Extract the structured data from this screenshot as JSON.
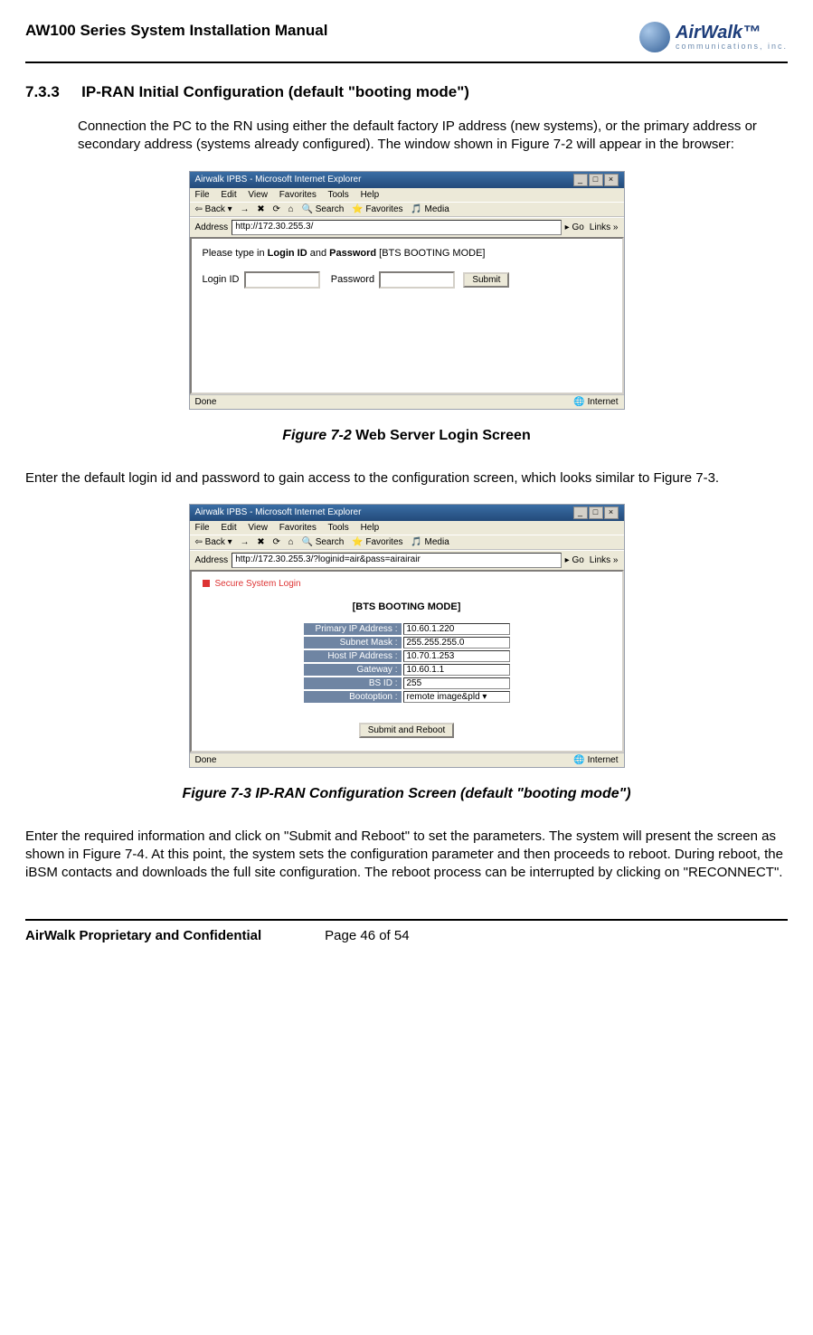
{
  "header": {
    "doc_title": "AW100 Series System Installation Manual",
    "logo_brand": "AirWalk",
    "logo_sub": "communications, inc."
  },
  "section": {
    "number": "7.3.3",
    "title": "IP-RAN Initial Configuration (default \"booting mode\")"
  },
  "para1": "Connection the PC to the RN using either the default factory IP address (new systems), or the primary address or secondary address (systems already configured). The window shown in Figure 7-2 will appear in the browser:",
  "fig1": {
    "window_title": "Airwalk IPBS - Microsoft Internet Explorer",
    "menubar": [
      "File",
      "Edit",
      "View",
      "Favorites",
      "Tools",
      "Help"
    ],
    "toolbar": {
      "back": "Back",
      "search": "Search",
      "favorites": "Favorites",
      "media": "Media"
    },
    "address_label": "Address",
    "address_url": "http://172.30.255.3/",
    "go": "Go",
    "links": "Links",
    "instruction_prefix": "Please type in ",
    "instruction_login": "Login ID",
    "instruction_and": " and ",
    "instruction_pass": "Password",
    "instruction_mode": " [BTS BOOTING MODE]",
    "login_label": "Login ID",
    "password_label": "Password",
    "submit": "Submit",
    "status_done": "Done",
    "status_net": "Internet"
  },
  "caption1": {
    "label": "Figure 7-2",
    "text": " Web Server Login Screen"
  },
  "para2": "Enter the default login id and password to gain access to the configuration screen, which looks similar to Figure 7-3.",
  "fig2": {
    "window_title": "Airwalk IPBS - Microsoft Internet Explorer",
    "menubar": [
      "File",
      "Edit",
      "View",
      "Favorites",
      "Tools",
      "Help"
    ],
    "toolbar": {
      "back": "Back",
      "search": "Search",
      "favorites": "Favorites",
      "media": "Media"
    },
    "address_label": "Address",
    "address_url": "http://172.30.255.3/?loginid=air&pass=airairair",
    "go": "Go",
    "links": "Links",
    "secure_login": "Secure System Login",
    "mode": "[BTS BOOTING MODE]",
    "rows": [
      {
        "label": "Primary IP Address :",
        "value": "10.60.1.220"
      },
      {
        "label": "Subnet Mask :",
        "value": "255.255.255.0"
      },
      {
        "label": "Host IP Address :",
        "value": "10.70.1.253"
      },
      {
        "label": "Gateway :",
        "value": "10.60.1.1"
      },
      {
        "label": "BS ID :",
        "value": "255"
      },
      {
        "label": "Bootoption :",
        "value": "remote image&pld"
      }
    ],
    "submit": "Submit and Reboot",
    "status_done": "Done",
    "status_net": "Internet"
  },
  "caption2": "Figure 7-3 IP-RAN Configuration Screen (default \"booting mode\")",
  "para3": "Enter the required information and click on \"Submit and Reboot\" to set the parameters. The system will present the screen as shown in Figure 7-4. At this point, the system sets the configuration parameter and then proceeds to reboot. During reboot, the iBSM contacts and downloads the full site configuration.  The reboot process can be interrupted by clicking on \"RECONNECT\".",
  "footer": {
    "proprietary": "AirWalk Proprietary and Confidential",
    "page": "Page 46 of 54"
  }
}
